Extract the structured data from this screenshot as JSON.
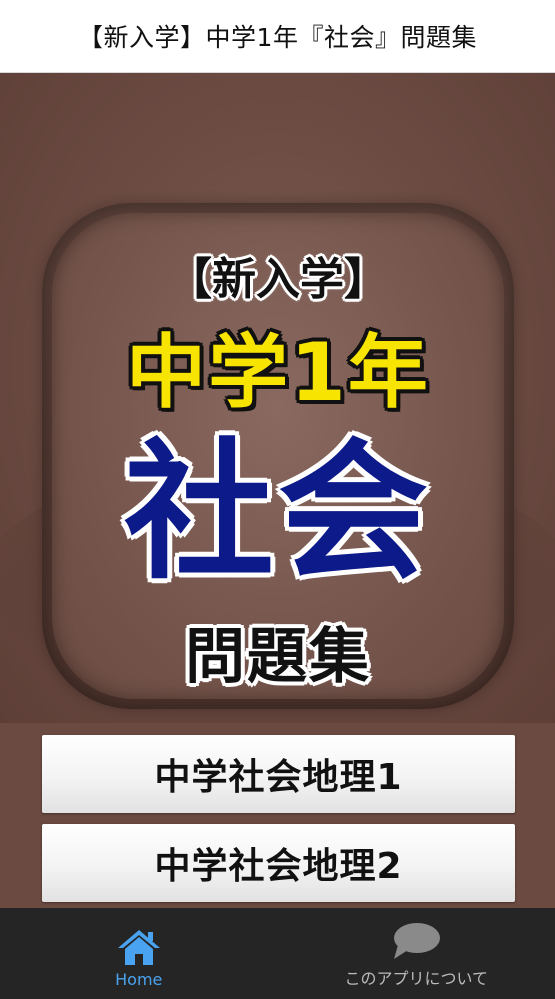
{
  "header": {
    "title": "【新入学】中学1年『社会』問題集"
  },
  "hero": {
    "subtitle": "【新入学】",
    "grade": "中学1年",
    "subject": "社会",
    "collection": "問題集"
  },
  "menu": [
    {
      "label": "中学社会地理1"
    },
    {
      "label": "中学社会地理2"
    }
  ],
  "nav": {
    "items": [
      {
        "label": "Home",
        "icon": "home-icon",
        "active": true
      },
      {
        "label": "このアプリについて",
        "icon": "chat-bubble-icon",
        "active": false
      }
    ]
  },
  "colors": {
    "background": "#6a4a41",
    "grade_text": "#f7e400",
    "subject_text": "#0d1a8a",
    "nav_background": "#252525",
    "nav_active": "#4aa3f0"
  }
}
